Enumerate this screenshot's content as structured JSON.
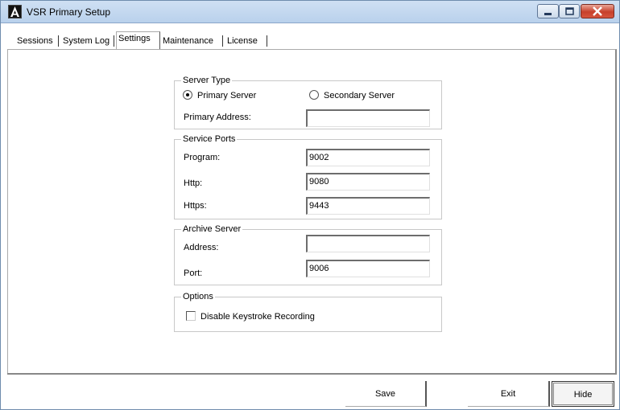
{
  "window": {
    "title": "VSR Primary Setup",
    "icon": "app-logo-icon"
  },
  "tabs": [
    {
      "label": "Sessions",
      "selected": false
    },
    {
      "label": "System Log",
      "selected": false
    },
    {
      "label": "Settings",
      "selected": true
    },
    {
      "label": "Maintenance",
      "selected": false
    },
    {
      "label": "License",
      "selected": false
    }
  ],
  "server_type": {
    "title": "Server Type",
    "primary_label": "Primary Server",
    "secondary_label": "Secondary Server",
    "selected": "primary",
    "address_label": "Primary Address:",
    "address_value": ""
  },
  "service_ports": {
    "title": "Service Ports",
    "program_label": "Program:",
    "program_value": "9002",
    "http_label": "Http:",
    "http_value": "9080",
    "https_label": "Https:",
    "https_value": "9443"
  },
  "archive_server": {
    "title": "Archive Server",
    "address_label": "Address:",
    "address_value": "",
    "port_label": "Port:",
    "port_value": "9006"
  },
  "options": {
    "title": "Options",
    "disable_keystroke_label": "Disable Keystroke Recording",
    "disable_keystroke_checked": false
  },
  "footer": {
    "save_label": "Save",
    "exit_label": "Exit",
    "hide_label": "Hide"
  }
}
